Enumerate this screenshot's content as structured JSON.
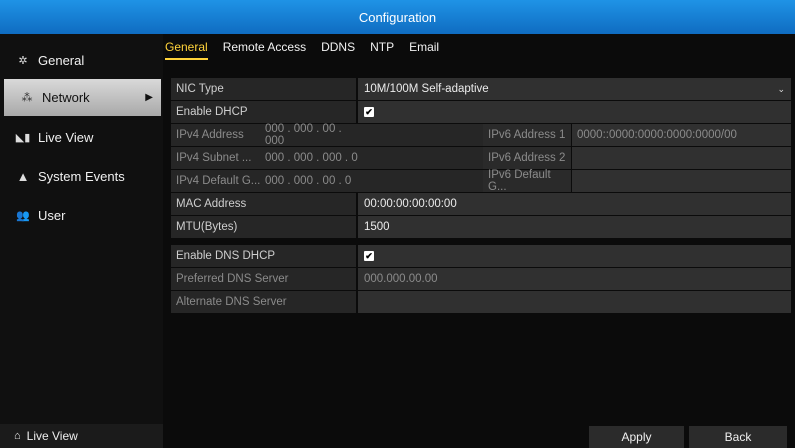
{
  "window": {
    "title": "Configuration"
  },
  "sidebar": {
    "items": [
      {
        "label": "General",
        "icon": "gear-icon"
      },
      {
        "label": "Network",
        "icon": "network-icon"
      },
      {
        "label": "Live View",
        "icon": "camera-icon"
      },
      {
        "label": "System Events",
        "icon": "warning-icon"
      },
      {
        "label": "User",
        "icon": "user-icon"
      }
    ],
    "bottom_label": "Live View"
  },
  "tabs": [
    "General",
    "Remote Access",
    "DDNS",
    "NTP",
    "Email"
  ],
  "form": {
    "nic_type_label": "NIC Type",
    "nic_type_value": "10M/100M Self-adaptive",
    "enable_dhcp_label": "Enable DHCP",
    "enable_dhcp_checked": true,
    "ipv4_address_label": "IPv4 Address",
    "ipv4_address_value": "000 . 000 . 00  . 000",
    "ipv4_subnet_label": "IPv4 Subnet ...",
    "ipv4_subnet_value": "000 . 000 . 000 . 0",
    "ipv4_gateway_label": "IPv4 Default G...",
    "ipv4_gateway_value": "000 . 000 . 00  . 0",
    "ipv6_address1_label": "IPv6 Address 1",
    "ipv6_address1_value": "0000::0000:0000:0000:0000/00",
    "ipv6_address2_label": "IPv6 Address 2",
    "ipv6_address2_value": "",
    "ipv6_gateway_label": "IPv6 Default G...",
    "ipv6_gateway_value": "",
    "mac_label": "MAC Address",
    "mac_value": "00:00:00:00:00:00",
    "mtu_label": "MTU(Bytes)",
    "mtu_value": "1500",
    "enable_dns_dhcp_label": "Enable DNS DHCP",
    "enable_dns_dhcp_checked": true,
    "preferred_dns_label": "Preferred DNS Server",
    "preferred_dns_value": "000.000.00.00",
    "alternate_dns_label": "Alternate DNS Server",
    "alternate_dns_value": ""
  },
  "buttons": {
    "apply": "Apply",
    "back": "Back"
  },
  "colors": {
    "titlebar": "#1479d3",
    "active_tab": "#ffd33a"
  }
}
